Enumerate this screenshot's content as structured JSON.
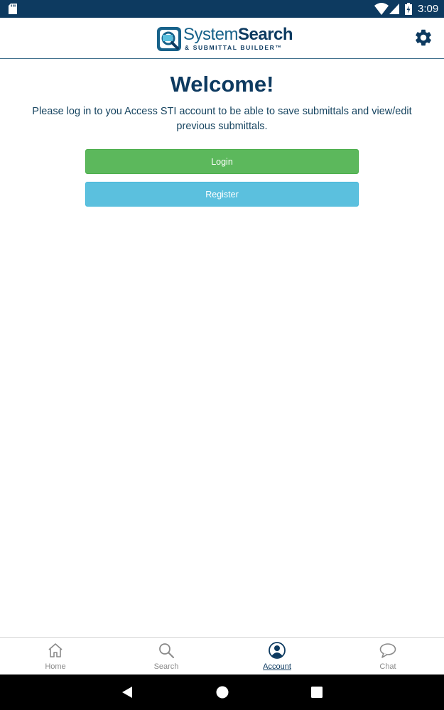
{
  "status_bar": {
    "time": "3:09",
    "icons": [
      "sd-card-icon",
      "wifi-icon",
      "signal-icon",
      "battery-charging-icon"
    ]
  },
  "header": {
    "logo_primary": "System",
    "logo_primary_bold": "Search",
    "logo_secondary": "& SUBMITTAL BUILDER™",
    "settings_icon": "gear-icon"
  },
  "main": {
    "title": "Welcome!",
    "intro": "Please log in to you Access STI account to be able to save submittals and view/edit previous submittals.",
    "login_label": "Login",
    "register_label": "Register"
  },
  "tabs": [
    {
      "label": "Home",
      "icon": "home-icon",
      "active": false
    },
    {
      "label": "Search",
      "icon": "search-icon",
      "active": false
    },
    {
      "label": "Account",
      "icon": "account-icon",
      "active": true
    },
    {
      "label": "Chat",
      "icon": "chat-bubble-icon",
      "active": false
    }
  ],
  "colors": {
    "primary_navy": "#0d3a60",
    "login_green": "#5cb85c",
    "register_blue": "#5bc0de",
    "inactive_gray": "#8a8a8a"
  }
}
